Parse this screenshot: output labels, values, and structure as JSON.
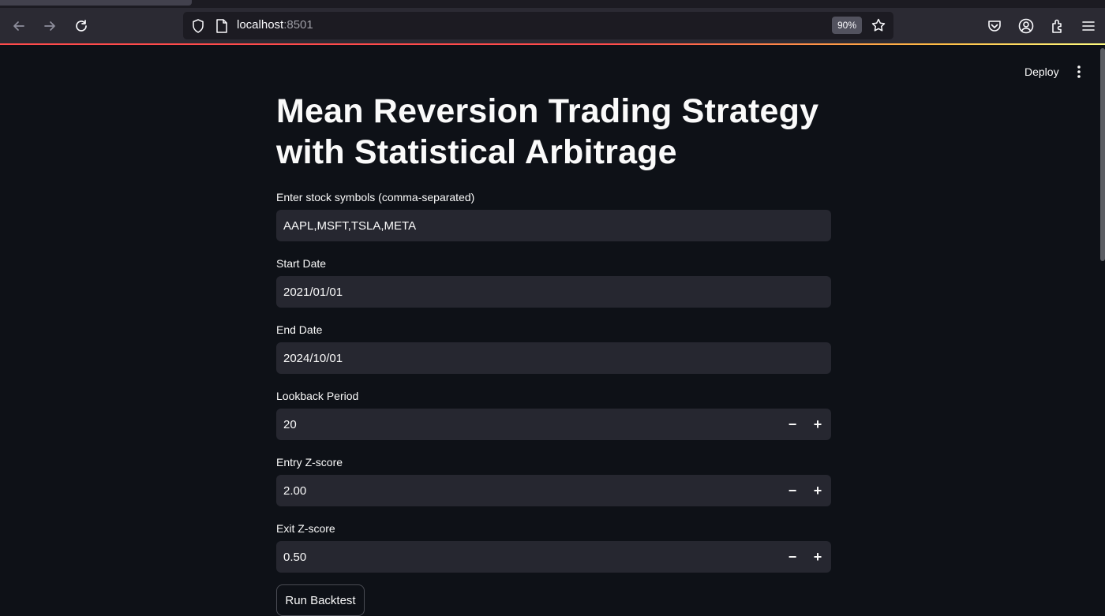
{
  "browser": {
    "url_host": "localhost",
    "url_port": ":8501",
    "zoom": "90%"
  },
  "header": {
    "deploy_label": "Deploy"
  },
  "main": {
    "title_line1": "Mean Reversion Trading Strategy",
    "title_line2": "with Statistical Arbitrage",
    "fields": [
      {
        "label": "Enter stock symbols (comma-separated)",
        "value": "AAPL,MSFT,TSLA,META"
      },
      {
        "label": "Start Date",
        "value": "2021/01/01"
      },
      {
        "label": "End Date",
        "value": "2024/10/01"
      },
      {
        "label": "Lookback Period",
        "value": "20",
        "decrement": "−",
        "increment": "+"
      },
      {
        "label": "Entry Z-score",
        "value": "2.00",
        "decrement": "−",
        "increment": "+"
      },
      {
        "label": "Exit Z-score",
        "value": "0.50",
        "decrement": "−",
        "increment": "+"
      }
    ],
    "run_button_label": "Run Backtest"
  }
}
